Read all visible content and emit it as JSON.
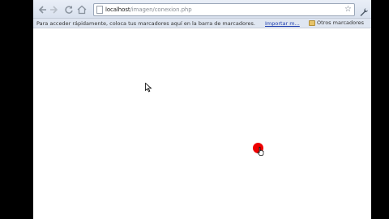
{
  "toolbar": {
    "back_icon": "back-arrow-icon",
    "forward_icon": "forward-arrow-icon",
    "reload_icon": "reload-icon",
    "home_icon": "home-icon",
    "url_host": "localhost",
    "url_path": "/imagen/conexion.php",
    "star_icon": "bookmark-star-icon",
    "wrench_icon": "wrench-icon"
  },
  "bookmarks_bar": {
    "hint": "Para acceder rápidamente, coloca tus marcadores aquí en la barra de marcadores.",
    "import_link": "Importar m...",
    "other_bookmarks": "Otros marcadores"
  },
  "colors": {
    "dot": "#ee0000",
    "toolbar": "#e1e7f2",
    "link": "#2040b0"
  }
}
